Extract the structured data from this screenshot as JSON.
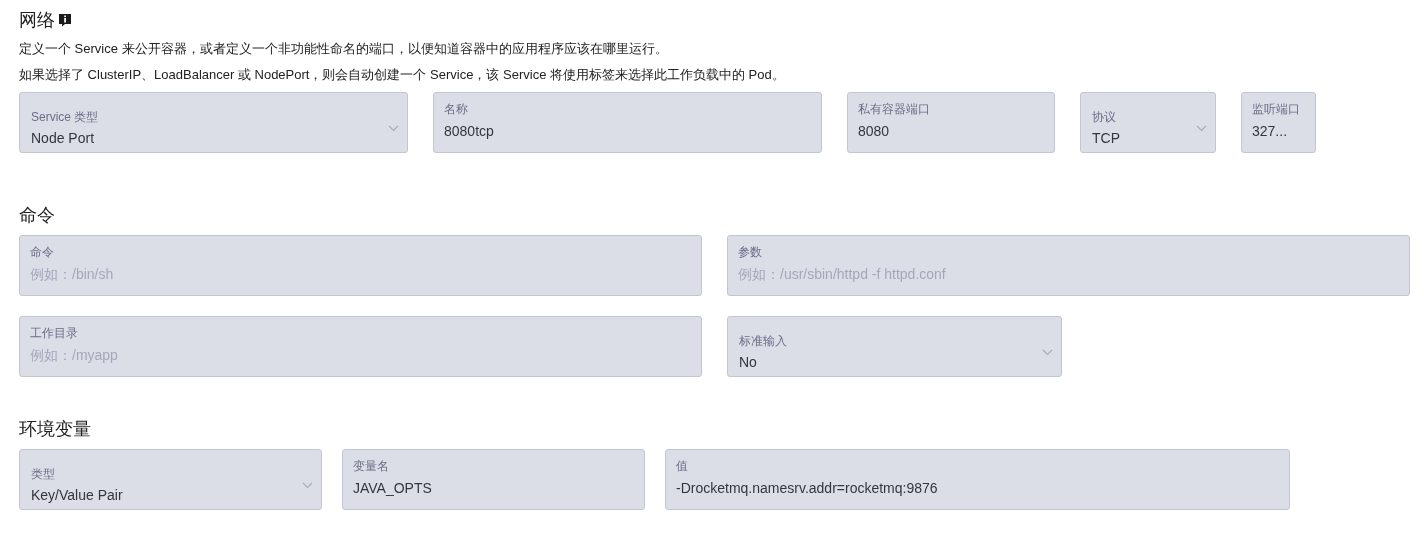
{
  "sections": [
    {
      "title": "网络",
      "has_info": true,
      "description": [
        "定义一个 Service 来公开容器，或者定义一个非功能性命名的端口，以便知道容器中的应用程序应该在哪里运行。",
        "如果选择了 ClusterIP、LoadBalancer 或 NodePort，则会自动创建一个 Service，该 Service 将使用标签来选择此工作负载中的 Pod。"
      ],
      "rows": [
        [
          {
            "kind": "select",
            "label": "Service 类型",
            "value": "Node Port"
          },
          {
            "kind": "input",
            "label": "名称",
            "value": "8080tcp"
          },
          {
            "kind": "input",
            "label": "私有容器端口",
            "value": "8080"
          },
          {
            "kind": "select",
            "label": "协议",
            "value": "TCP"
          },
          {
            "kind": "input",
            "label": "监听端口",
            "value": "327..."
          }
        ]
      ]
    },
    {
      "title": "命令",
      "has_info": false,
      "rows": [
        [
          {
            "kind": "input",
            "label": "命令",
            "placeholder": "例如：/bin/sh"
          },
          {
            "kind": "input",
            "label": "参数",
            "placeholder": "例如：/usr/sbin/httpd -f httpd.conf"
          }
        ],
        [
          {
            "kind": "input",
            "label": "工作目录",
            "placeholder": "例如：/myapp"
          },
          {
            "kind": "select",
            "label": "标准输入",
            "value": "No"
          }
        ]
      ]
    },
    {
      "title": "环境变量",
      "has_info": false,
      "rows": [
        [
          {
            "kind": "select",
            "label": "类型",
            "value": "Key/Value Pair"
          },
          {
            "kind": "input",
            "label": "变量名",
            "value": "JAVA_OPTS"
          },
          {
            "kind": "input",
            "label": "值",
            "value": "-Drocketmq.namesrv.addr=rocketmq:9876"
          }
        ]
      ]
    }
  ]
}
